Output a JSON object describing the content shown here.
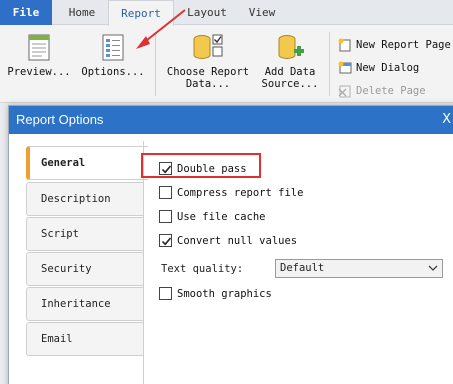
{
  "ribbon": {
    "tabs": [
      {
        "label": "File"
      },
      {
        "label": "Home"
      },
      {
        "label": "Report"
      },
      {
        "label": "Layout"
      },
      {
        "label": "View"
      }
    ],
    "active_tab": "Report",
    "buttons": {
      "preview": {
        "label": "Preview...",
        "icon": "report-preview-icon"
      },
      "options": {
        "label": "Options...",
        "icon": "report-options-icon"
      },
      "choose_data": {
        "line1": "Choose Report",
        "line2": "Data...",
        "icon": "database-check-icon"
      },
      "add_data": {
        "line1": "Add Data",
        "line2": "Source...",
        "icon": "database-add-icon"
      }
    },
    "small_buttons": [
      {
        "label": "New Report Page",
        "icon": "new-page-icon"
      },
      {
        "label": "New Dialog",
        "icon": "new-dialog-icon"
      },
      {
        "label": "Delete Page",
        "icon": "delete-page-icon",
        "disabled": true
      }
    ]
  },
  "dialog": {
    "title": "Report Options",
    "close_glyph": "X",
    "side_tabs": [
      "General",
      "Description",
      "Script",
      "Security",
      "Inheritance",
      "Email"
    ],
    "active_side_tab": "General",
    "options": {
      "double_pass": {
        "label": "Double pass",
        "checked": true
      },
      "compress": {
        "label": "Compress report file",
        "checked": false
      },
      "file_cache": {
        "label": "Use file cache",
        "checked": false
      },
      "convert_null": {
        "label": "Convert null values",
        "checked": true
      },
      "smooth": {
        "label": "Smooth graphics",
        "checked": false
      }
    },
    "text_quality": {
      "label": "Text quality:",
      "value": "Default"
    }
  },
  "colors": {
    "file_tab": "#2f6fc7",
    "titlebar": "#2c72c7",
    "highlight": "#e03030",
    "active_tab_accent": "#f0a030"
  }
}
